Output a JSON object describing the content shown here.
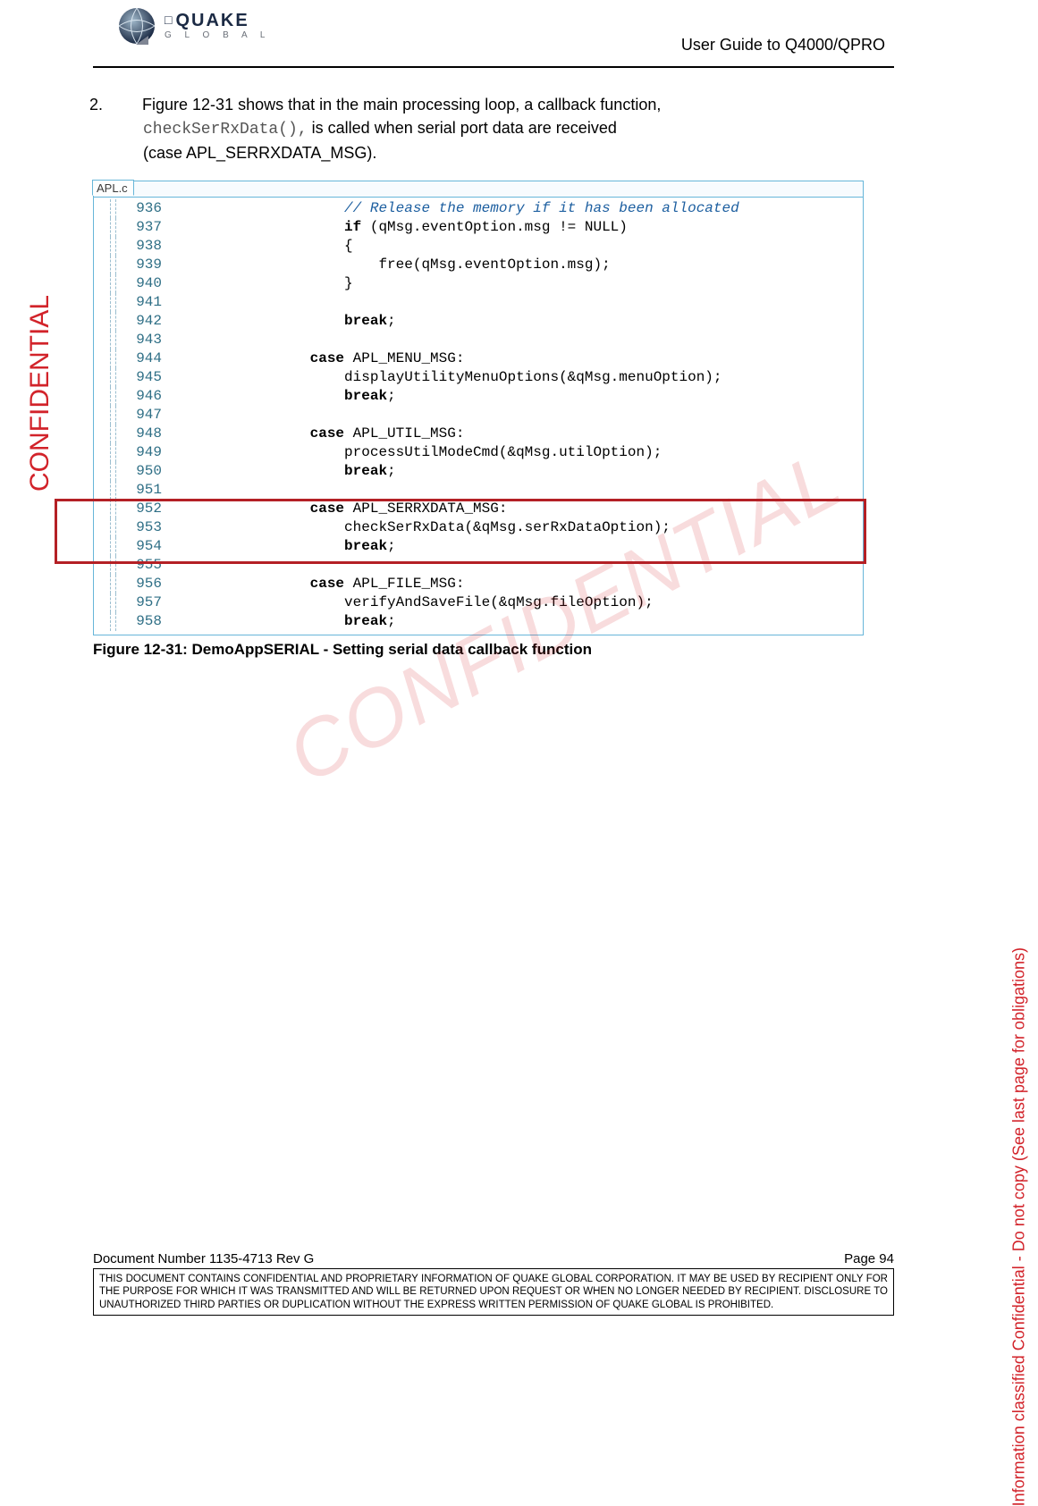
{
  "logo": {
    "brand": "QUAKE",
    "sub": "G L O B A L"
  },
  "header": {
    "title": "User Guide to Q4000/QPRO"
  },
  "para": {
    "num": "2.",
    "pre_ref": "Figure 12-31 shows that in the main processing loop, a callback function, ",
    "fn": "checkSerRxData(),",
    "post_fn": " is called when serial port data are received",
    "case_line": "(case  APL_SERRXDATA_MSG)."
  },
  "code": {
    "tab": "APL.c",
    "lines": [
      {
        "n": "936",
        "indent": "                    ",
        "cls": "cm",
        "t": "// Release the memory if it has been allocated"
      },
      {
        "n": "937",
        "indent": "                    ",
        "seg": [
          {
            "cls": "kw",
            "t": "if"
          },
          {
            "cls": "txt",
            "t": " (qMsg.eventOption.msg != NULL)"
          }
        ]
      },
      {
        "n": "938",
        "indent": "                    ",
        "cls": "txt",
        "t": "{"
      },
      {
        "n": "939",
        "indent": "                        ",
        "cls": "txt",
        "t": "free(qMsg.eventOption.msg);"
      },
      {
        "n": "940",
        "indent": "                    ",
        "cls": "txt",
        "t": "}"
      },
      {
        "n": "941",
        "indent": "",
        "cls": "txt",
        "t": ""
      },
      {
        "n": "942",
        "indent": "                    ",
        "seg": [
          {
            "cls": "kw",
            "t": "break"
          },
          {
            "cls": "txt",
            "t": ";"
          }
        ]
      },
      {
        "n": "943",
        "indent": "",
        "cls": "txt",
        "t": ""
      },
      {
        "n": "944",
        "indent": "                ",
        "seg": [
          {
            "cls": "kw",
            "t": "case"
          },
          {
            "cls": "txt",
            "t": " APL_MENU_MSG:"
          }
        ]
      },
      {
        "n": "945",
        "indent": "                    ",
        "cls": "txt",
        "t": "displayUtilityMenuOptions(&qMsg.menuOption);"
      },
      {
        "n": "946",
        "indent": "                    ",
        "seg": [
          {
            "cls": "kw",
            "t": "break"
          },
          {
            "cls": "txt",
            "t": ";"
          }
        ]
      },
      {
        "n": "947",
        "indent": "",
        "cls": "txt",
        "t": ""
      },
      {
        "n": "948",
        "indent": "                ",
        "seg": [
          {
            "cls": "kw",
            "t": "case"
          },
          {
            "cls": "txt",
            "t": " APL_UTIL_MSG:"
          }
        ]
      },
      {
        "n": "949",
        "indent": "                    ",
        "cls": "txt",
        "t": "processUtilModeCmd(&qMsg.utilOption);"
      },
      {
        "n": "950",
        "indent": "                    ",
        "seg": [
          {
            "cls": "kw",
            "t": "break"
          },
          {
            "cls": "txt",
            "t": ";"
          }
        ]
      },
      {
        "n": "951",
        "indent": "",
        "cls": "txt",
        "t": ""
      },
      {
        "n": "952",
        "indent": "                ",
        "seg": [
          {
            "cls": "kw",
            "t": "case"
          },
          {
            "cls": "txt",
            "t": " APL_SERRXDATA_MSG:"
          }
        ]
      },
      {
        "n": "953",
        "indent": "                    ",
        "cls": "txt",
        "t": "checkSerRxData(&qMsg.serRxDataOption);"
      },
      {
        "n": "954",
        "indent": "                    ",
        "seg": [
          {
            "cls": "kw",
            "t": "break"
          },
          {
            "cls": "txt",
            "t": ";"
          }
        ]
      },
      {
        "n": "955",
        "indent": "",
        "cls": "txt",
        "t": ""
      },
      {
        "n": "956",
        "indent": "                ",
        "seg": [
          {
            "cls": "kw",
            "t": "case"
          },
          {
            "cls": "txt",
            "t": " APL_FILE_MSG:"
          }
        ]
      },
      {
        "n": "957",
        "indent": "                    ",
        "cls": "txt",
        "t": "verifyAndSaveFile(&qMsg.fileOption);"
      },
      {
        "n": "958",
        "indent": "                    ",
        "seg": [
          {
            "cls": "kw",
            "t": "break"
          },
          {
            "cls": "txt",
            "t": ";"
          }
        ]
      }
    ],
    "highlight": {
      "start": "952",
      "end": "954"
    }
  },
  "caption": "Figure 12-31:  DemoAppSERIAL -  Setting serial data callback function",
  "watermarks": {
    "left": "CONFIDENTIAL",
    "right": "Information classified Confidential - Do not copy (See last page for obligations)",
    "diagonal": "CONFIDENTIAL"
  },
  "footer": {
    "doc": "Document Number 1135-4713   Rev G",
    "page": "Page 94",
    "notice": "THIS DOCUMENT CONTAINS CONFIDENTIAL AND PROPRIETARY INFORMATION OF QUAKE GLOBAL CORPORATION.  IT MAY BE USED BY RECIPIENT ONLY FOR THE PURPOSE FOR WHICH IT WAS TRANSMITTED AND WILL BE RETURNED UPON REQUEST OR WHEN NO LONGER NEEDED BY RECIPIENT.  DISCLOSURE TO UNAUTHORIZED THIRD PARTIES OR DUPLICATION WITHOUT THE EXPRESS WRITTEN PERMISSION OF QUAKE GLOBAL IS PROHIBITED."
  }
}
